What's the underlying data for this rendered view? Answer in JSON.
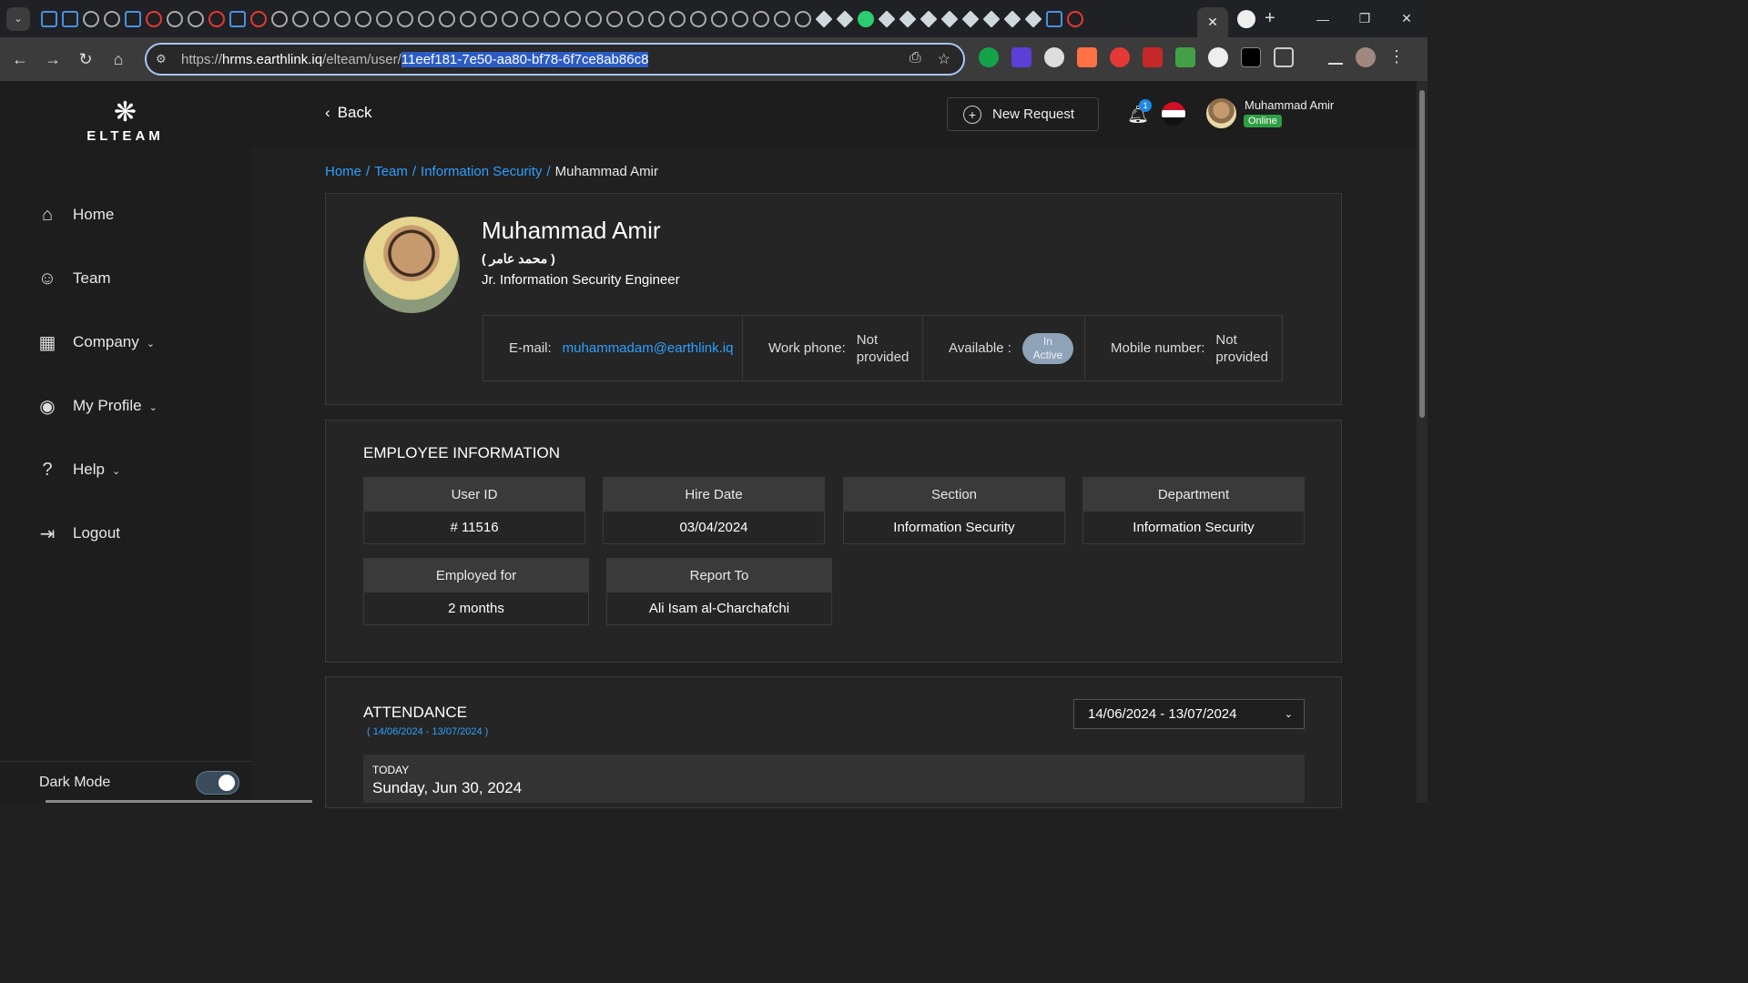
{
  "browser": {
    "url_prefix": "https://",
    "url_host": "hrms.earthlink.iq",
    "url_path": "/elteam/user/",
    "url_selected": "11eef181-7e50-aa80-bf78-6f7ce8ab86c8"
  },
  "sidebar": {
    "logo_text": "ELTEAM",
    "items": [
      {
        "label": "Home",
        "icon": "home-icon"
      },
      {
        "label": "Team",
        "icon": "team-icon"
      },
      {
        "label": "Company",
        "icon": "building-icon"
      },
      {
        "label": "My Profile",
        "icon": "user-circle-icon"
      },
      {
        "label": "Help",
        "icon": "help-icon"
      },
      {
        "label": "Logout",
        "icon": "logout-icon"
      }
    ],
    "dark_mode_label": "Dark Mode"
  },
  "header": {
    "back_label": "Back",
    "new_request_label": "New Request",
    "notification_count": "1",
    "user_name": "Muhammad Amir",
    "user_status": "Online"
  },
  "breadcrumb": {
    "home": "Home",
    "team": "Team",
    "section": "Information Security",
    "current": "Muhammad Amir"
  },
  "profile": {
    "name": "Muhammad Amir",
    "arabic_name": "( محمد عامر )",
    "title": "Jr. Information Security Engineer",
    "email_label": "E-mail:",
    "email": "muhammadam@earthlink.iq",
    "work_phone_label": "Work phone:",
    "work_phone_line1": "Not",
    "work_phone_line2": "provided",
    "available_label": "Available :",
    "available_line1": "In",
    "available_line2": "Active",
    "mobile_label": "Mobile number:",
    "mobile_line1": "Not",
    "mobile_line2": "provided"
  },
  "employee_info": {
    "title": "EMPLOYEE INFORMATION",
    "user_id_label": "User ID",
    "user_id": "# 11516",
    "hire_date_label": "Hire Date",
    "hire_date": "03/04/2024",
    "section_label": "Section",
    "section": "Information Security",
    "department_label": "Department",
    "department": "Information Security",
    "employed_for_label": "Employed for",
    "employed_for": "2 months",
    "report_to_label": "Report To",
    "report_to": "Ali Isam al-Charchafchi"
  },
  "attendance": {
    "title": "ATTENDANCE",
    "range_sub": "( 14/06/2024 - 13/07/2024 )",
    "range_select": "14/06/2024 - 13/07/2024",
    "today_label": "TODAY",
    "today_date": "Sunday, Jun 30, 2024"
  }
}
